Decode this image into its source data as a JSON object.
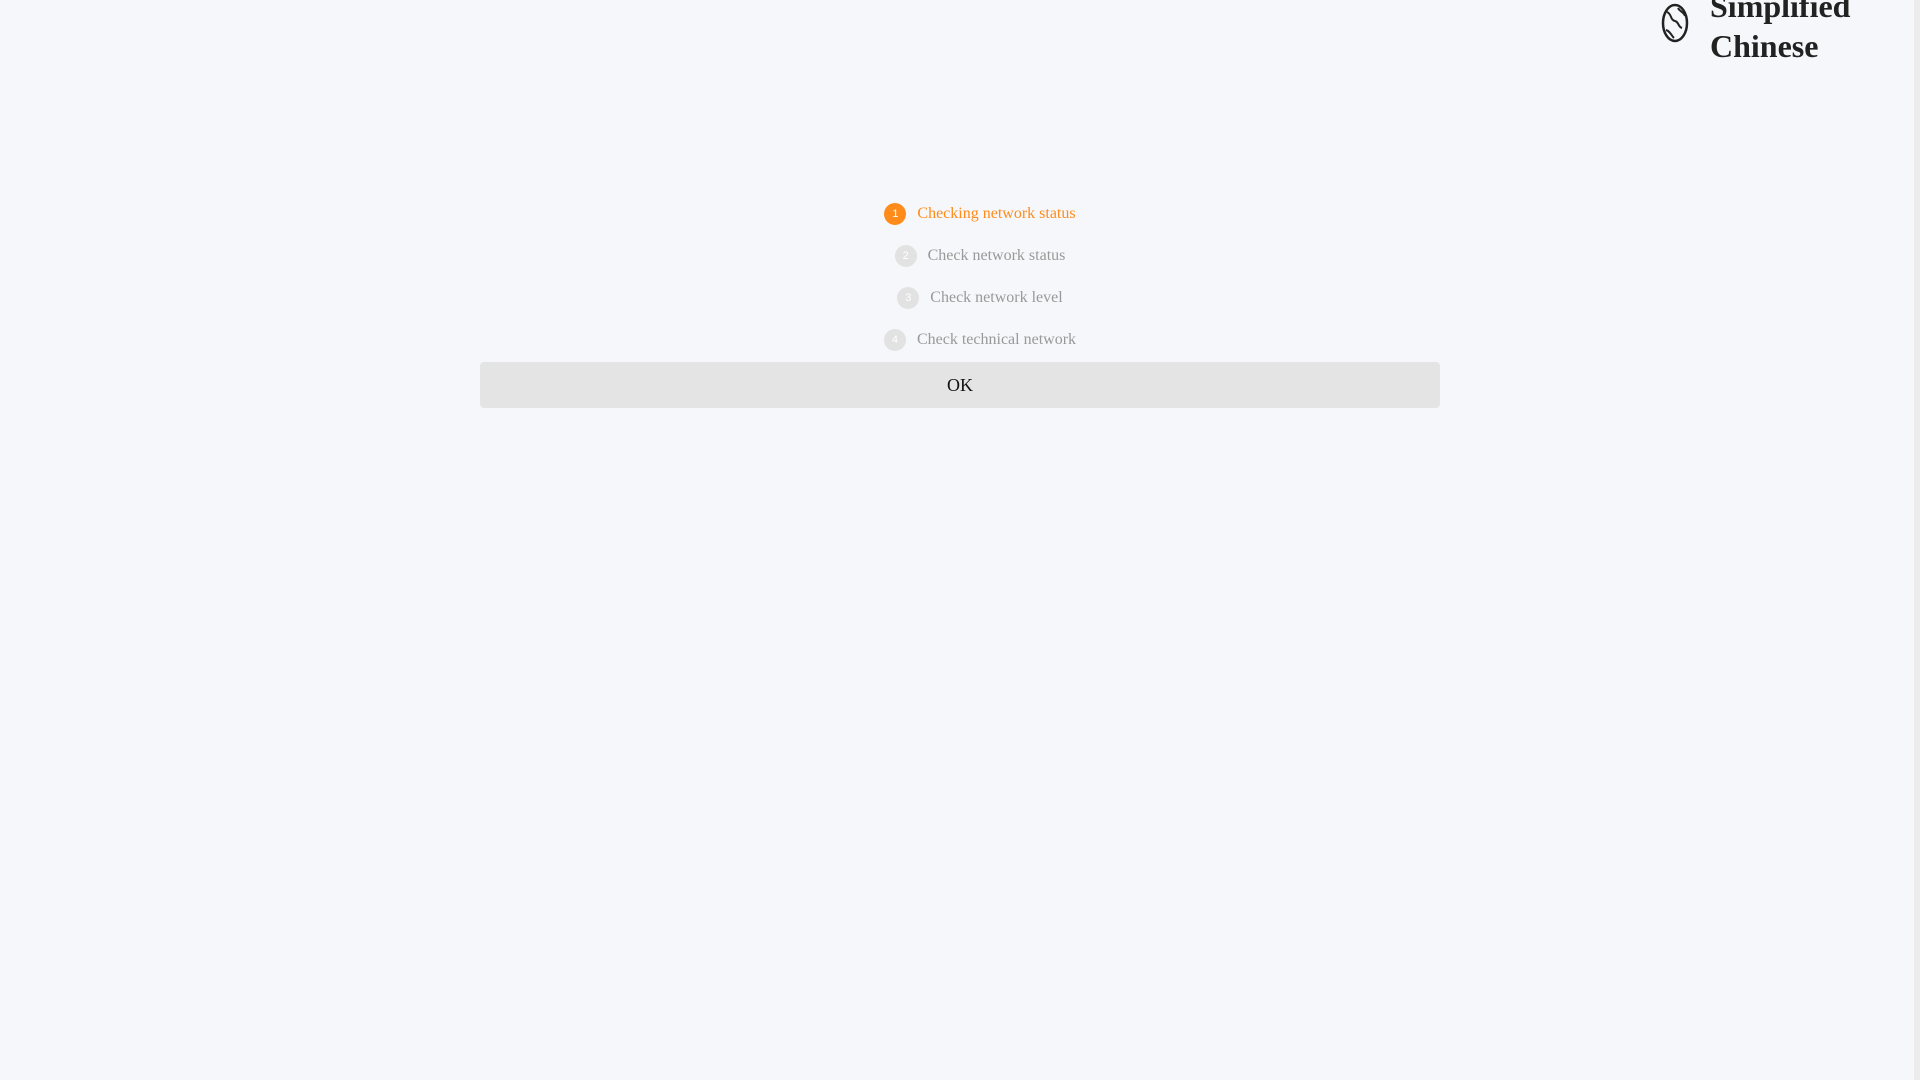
{
  "language_switch": {
    "icon": "globe-icon",
    "label": "Simplified Chinese"
  },
  "steps": [
    {
      "number": "1",
      "label": "Checking network status",
      "active": true
    },
    {
      "number": "2",
      "label": "Check network status",
      "active": false
    },
    {
      "number": "3",
      "label": "Check network level",
      "active": false
    },
    {
      "number": "4",
      "label": "Check technical network",
      "active": false
    }
  ],
  "ok_button": {
    "label": "OK"
  },
  "colors": {
    "accent": "#ff8c1a",
    "inactive_text": "#999999",
    "inactive_badge": "#e2e2e2",
    "background": "#f5f7fa",
    "button_bg": "#e4e4e4"
  }
}
